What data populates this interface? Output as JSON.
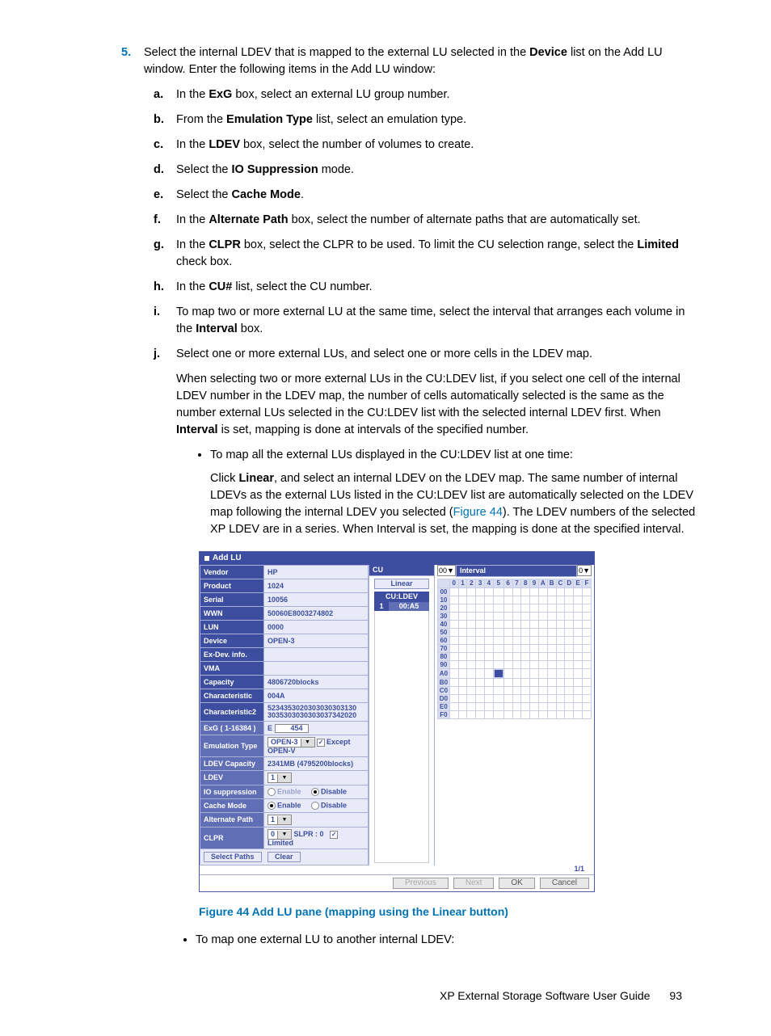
{
  "step": {
    "num": "5.",
    "intro_a": "Select the internal LDEV that is mapped to the external LU selected in the ",
    "intro_b": " list on the Add LU window. Enter the following items in the Add LU window:",
    "device": "Device"
  },
  "subs": {
    "a": {
      "n": "a.",
      "t1": "In the ",
      "b": "ExG",
      "t2": " box, select an external LU group number."
    },
    "b": {
      "n": "b.",
      "t1": "From the ",
      "b": "Emulation Type",
      "t2": " list, select an emulation type."
    },
    "c": {
      "n": "c.",
      "t1": "In the ",
      "b": "LDEV",
      "t2": " box, select the number of volumes to create."
    },
    "d": {
      "n": "d.",
      "t1": "Select the ",
      "b": "IO Suppression",
      "t2": " mode."
    },
    "e": {
      "n": "e.",
      "t1": "Select the ",
      "b": "Cache Mode",
      "t2": "."
    },
    "f": {
      "n": "f.",
      "t1": "In the ",
      "b": "Alternate Path",
      "t2": " box, select the number of alternate paths that are automatically set."
    },
    "g": {
      "n": "g.",
      "t1": "In the ",
      "b": "CLPR",
      "t2": " box, select the CLPR to be used. To limit the CU selection range, select the ",
      "b2": "Limited",
      "t3": " check box."
    },
    "h": {
      "n": "h.",
      "t1": "In the ",
      "b": "CU#",
      "t2": " list, select the CU number."
    },
    "i": {
      "n": "i.",
      "t1": "To map two or more external LU at the same time, select the interval that arranges each volume in the ",
      "b": "Interval",
      "t2": " box."
    },
    "j": {
      "n": "j.",
      "t1": "Select one or more external LUs, and select one or more cells in the LDEV map.",
      "p1": "When selecting two or more external LUs in the CU:LDEV list, if you select one cell of the internal LDEV number in the LDEV map, the number of cells automatically selected is the same as the number external LUs selected in the CU:LDEV list with the selected internal LDEV first. When ",
      "pb": "Interval",
      "p2": " is set, mapping is done at intervals of the specified number."
    }
  },
  "bullet1": {
    "lead": "To map all the external LUs displayed in the CU:LDEV list at one time:",
    "t1": "Click ",
    "b1": "Linear",
    "t2": ", and select an internal LDEV on the LDEV map. The same number of internal LDEVs as the external LUs listed in the CU:LDEV list are automatically selected on the LDEV map following the internal LDEV you selected (",
    "link": "Figure 44",
    "t3": "). The LDEV numbers of the selected XP LDEV are in a series. When Interval is set, the mapping is done at the specified interval."
  },
  "bullet2": "To map one external LU to another internal LDEV:",
  "caption": "Figure 44 Add LU pane (mapping using the Linear button)",
  "footer": {
    "title": "XP External Storage Software User Guide",
    "page": "93"
  },
  "dlg": {
    "title": "Add LU",
    "left": [
      {
        "lab": "Vendor",
        "val": "HP"
      },
      {
        "lab": "Product",
        "val": "1024"
      },
      {
        "lab": "Serial",
        "val": "10056"
      },
      {
        "lab": "WWN",
        "val": "50060E8003274802"
      },
      {
        "lab": "LUN",
        "val": "0000"
      },
      {
        "lab": "Device",
        "val": "OPEN-3"
      },
      {
        "lab": "Ex-Dev. info.",
        "val": ""
      },
      {
        "lab": "VMA",
        "val": ""
      },
      {
        "lab": "Capacity",
        "val": "4806720blocks"
      },
      {
        "lab": "Characteristic",
        "val": "004A"
      },
      {
        "lab": "Characteristic2",
        "val": "5234353020303030303130 3035303030303037342020"
      }
    ],
    "exg": {
      "lab": "ExG ( 1-16384 )",
      "pre": "E",
      "val": "454"
    },
    "emu": {
      "lab": "Emulation Type",
      "val": "OPEN-3",
      "chk": "Except OPEN-V"
    },
    "ldevcap": {
      "lab": "LDEV Capacity",
      "val": "2341MB (4795200blocks)"
    },
    "ldev": {
      "lab": "LDEV",
      "val": "1"
    },
    "iosup": {
      "lab": "IO suppression",
      "en": "Enable",
      "dis": "Disable"
    },
    "cache": {
      "lab": "Cache Mode",
      "en": "Enable",
      "dis": "Disable"
    },
    "altpath": {
      "lab": "Alternate Path",
      "val": "1"
    },
    "clpr": {
      "lab": "CLPR",
      "val": "0",
      "slpr": "SLPR : 0",
      "lim": "Limited"
    },
    "btns": {
      "selpaths": "Select Paths",
      "clear": "Clear"
    },
    "mid": {
      "linear": "Linear",
      "hdr": "CU:LDEV",
      "row_n": "1",
      "row_v": "00:A5"
    },
    "top": {
      "cu": "CU",
      "cu_v": "00",
      "interval": "Interval",
      "interval_v": "0"
    },
    "cols": [
      "0",
      "1",
      "2",
      "3",
      "4",
      "5",
      "6",
      "7",
      "8",
      "9",
      "A",
      "B",
      "C",
      "D",
      "E",
      "F"
    ],
    "rows": [
      "00",
      "10",
      "20",
      "30",
      "40",
      "50",
      "60",
      "70",
      "80",
      "90",
      "A0",
      "B0",
      "C0",
      "D0",
      "E0",
      "F0"
    ],
    "sel_row": "A0",
    "sel_col": "5",
    "page": "1/1",
    "footer": {
      "prev": "Previous",
      "next": "Next",
      "ok": "OK",
      "cancel": "Cancel"
    }
  }
}
